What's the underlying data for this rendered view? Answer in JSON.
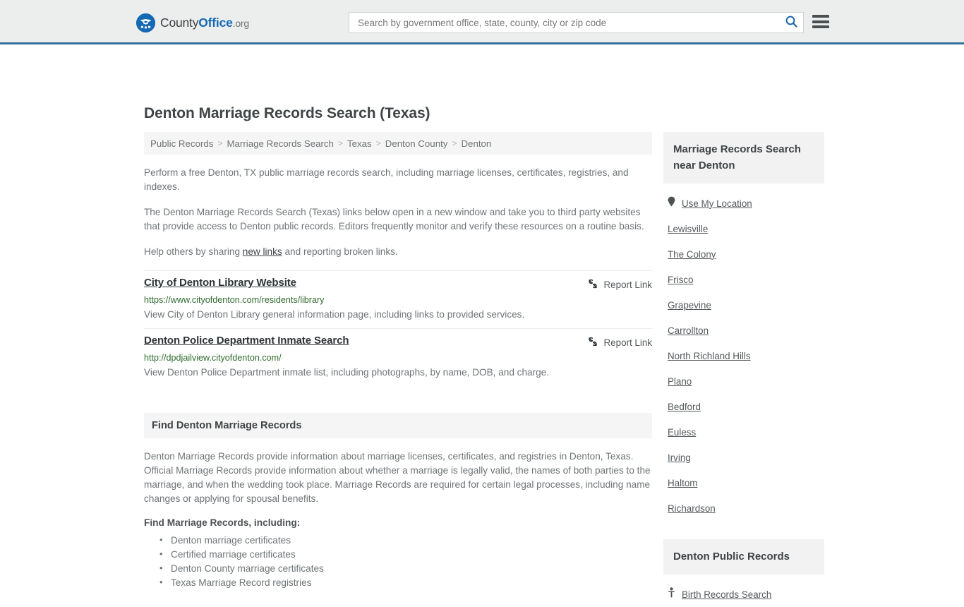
{
  "header": {
    "logo": {
      "icon": "countyoffice-eagle-logo-icon",
      "part1": "County",
      "part2": "Office",
      "part3": ".org"
    },
    "search": {
      "placeholder": "Search by government office, state, county, city or zip code",
      "value": "",
      "icon": "search-icon"
    },
    "menu_icon": "hamburger-menu-icon",
    "accent_color": "#33729f",
    "background_color": "#eceded"
  },
  "main": {
    "title": "Denton Marriage Records Search (Texas)",
    "breadcrumb": [
      "Public Records",
      "Marriage Records Search",
      "Texas",
      "Denton County",
      "Denton"
    ],
    "breadcrumb_separator": ">",
    "paragraphs": {
      "p1": "Perform a free Denton, TX public marriage records search, including marriage licenses, certificates, registries, and indexes.",
      "p2": "The Denton Marriage Records Search (Texas) links below open in a new window and take you to third party websites that provide access to Denton public records. Editors frequently monitor and verify these resources on a routine basis.",
      "p3_before": "Help others by sharing ",
      "p3_link": "new links",
      "p3_after": " and reporting broken links."
    },
    "report_link_label": "Report Link",
    "report_link_icon": "broken-link-icon",
    "links": [
      {
        "title": "City of Denton Library Website",
        "url": "https://www.cityofdenton.com/residents/library",
        "description": "View City of Denton Library general information page, including links to provided services."
      },
      {
        "title": "Denton Police Department Inmate Search",
        "url": "http://dpdjailview.cityofdenton.com/",
        "description": "View Denton Police Department inmate list, including photographs, by name, DOB, and charge."
      }
    ],
    "section": {
      "heading": "Find Denton Marriage Records",
      "body": "Denton Marriage Records provide information about marriage licenses, certificates, and registries in Denton, Texas. Official Marriage Records provide information about whether a marriage is legally valid, the names of both parties to the marriage, and when the wedding took place. Marriage Records are required for certain legal processes, including name changes or applying for spousal benefits.",
      "list_heading": "Find Marriage Records, including:",
      "list_items": [
        "Denton marriage certificates",
        "Certified marriage certificates",
        "Denton County marriage certificates",
        "Texas Marriage Record registries"
      ]
    },
    "url_color": "#2e6b2e"
  },
  "sidebar": {
    "nearby": {
      "heading": "Marriage Records Search near Denton",
      "use_my_location": {
        "label": "Use My Location",
        "icon": "map-pin-icon"
      },
      "cities": [
        "Lewisville",
        "The Colony",
        "Frisco",
        "Grapevine",
        "Carrollton",
        "North Richland Hills",
        "Plano",
        "Bedford",
        "Euless",
        "Irving",
        "Haltom",
        "Richardson"
      ]
    },
    "public_records": {
      "heading": "Denton Public Records",
      "items": [
        {
          "label": "Birth Records Search",
          "icon": "baby-icon"
        }
      ]
    }
  }
}
